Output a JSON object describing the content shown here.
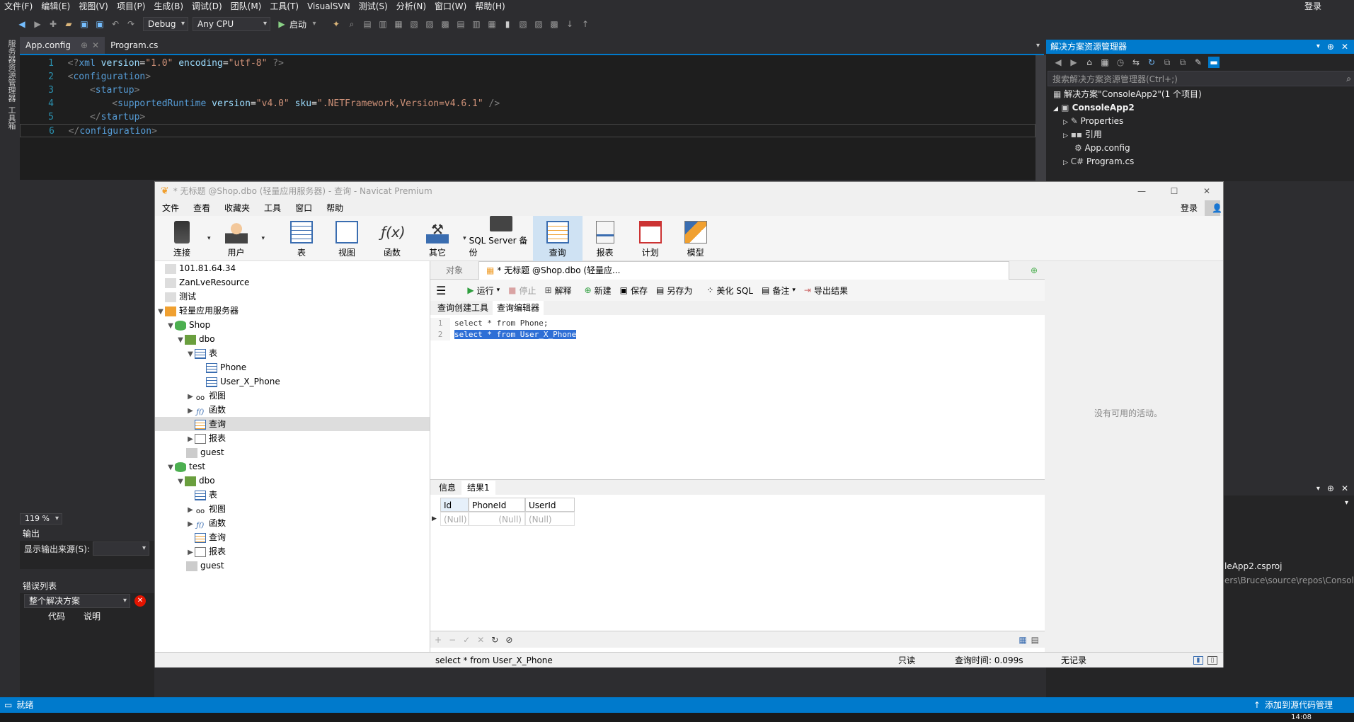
{
  "vs": {
    "menu": [
      "文件(F)",
      "编辑(E)",
      "视图(V)",
      "项目(P)",
      "生成(B)",
      "调试(D)",
      "团队(M)",
      "工具(T)",
      "VisualSVN",
      "测试(S)",
      "分析(N)",
      "窗口(W)",
      "帮助(H)"
    ],
    "login": "登录",
    "config": "Debug",
    "platform": "Any CPU",
    "start": "启动",
    "left_strip": [
      "服务器资源管理器",
      "工具箱"
    ],
    "tabs": [
      {
        "label": "App.config"
      },
      {
        "label": "Program.cs"
      }
    ],
    "code": [
      {
        "n": "1",
        "html": "<span class='xml-b'>&lt;?</span><span class='xml-t'>xml</span> <span class='xml-a'>version</span>=<span class='xml-v'>\"1.0\"</span> <span class='xml-a'>encoding</span>=<span class='xml-v'>\"utf-8\"</span> <span class='xml-b'>?&gt;</span>"
      },
      {
        "n": "2",
        "html": "<span class='xml-b'>&lt;</span><span class='xml-t'>configuration</span><span class='xml-b'>&gt;</span>"
      },
      {
        "n": "3",
        "html": "    <span class='xml-b'>&lt;</span><span class='xml-t'>startup</span><span class='xml-b'>&gt;</span>"
      },
      {
        "n": "4",
        "html": "        <span class='xml-b'>&lt;</span><span class='xml-t'>supportedRuntime</span> <span class='xml-a'>version</span>=<span class='xml-v'>\"v4.0\"</span> <span class='xml-a'>sku</span>=<span class='xml-v'>\".NETFramework,Version=v4.6.1\"</span> <span class='xml-b'>/&gt;</span>"
      },
      {
        "n": "5",
        "html": "    <span class='xml-b'>&lt;/</span><span class='xml-t'>startup</span><span class='xml-b'>&gt;</span>"
      },
      {
        "n": "6",
        "html": "<span class='xml-b'>&lt;/</span><span class='xml-t'>configuration</span><span class='xml-b'>&gt;</span>"
      }
    ],
    "zoom": "119 %",
    "output_title": "输出",
    "output_source_label": "显示输出来源(S):",
    "errors_title": "错误列表",
    "errors_scope": "整个解决方案",
    "errors_col_code": "代码",
    "errors_col_desc": "说明",
    "solution": {
      "title": "解决方案资源管理器",
      "search_placeholder": "搜索解决方案资源管理器(Ctrl+;)",
      "items": [
        "解决方案\"ConsoleApp2\"(1 个项目)",
        "ConsoleApp2",
        "Properties",
        "引用",
        "App.config",
        "Program.cs"
      ],
      "lower_items": [
        "leApp2.csproj",
        "ers\\Bruce\\source\\repos\\Consol"
      ]
    },
    "status": "就绪",
    "status_right": "添加到源代码管理",
    "clock": "14:08"
  },
  "navicat": {
    "title": "* 无标题 @Shop.dbo (轻量应用服务器) - 查询 - Navicat Premium",
    "menu": [
      "文件",
      "查看",
      "收藏夹",
      "工具",
      "窗口",
      "帮助"
    ],
    "login": "登录",
    "ribbon": [
      {
        "label": "连接",
        "icon": "plug-icon"
      },
      {
        "label": "用户",
        "icon": "user-icon"
      },
      {
        "label": "表",
        "icon": "table-icon"
      },
      {
        "label": "视图",
        "icon": "view-icon"
      },
      {
        "label": "函数",
        "icon": "function-icon"
      },
      {
        "label": "其它",
        "icon": "tools-icon"
      },
      {
        "label": "SQL Server 备份",
        "icon": "backup-icon"
      },
      {
        "label": "查询",
        "icon": "query-icon"
      },
      {
        "label": "报表",
        "icon": "report-icon"
      },
      {
        "label": "计划",
        "icon": "schedule-icon"
      },
      {
        "label": "模型",
        "icon": "model-icon"
      }
    ],
    "tree": [
      "101.81.64.34",
      "ZanLveResource",
      "测试",
      "轻量应用服务器",
      "Shop",
      "dbo",
      "表",
      "Phone",
      "User_X_Phone",
      "视图",
      "函数",
      "查询",
      "报表",
      "guest",
      "test",
      "dbo",
      "表",
      "视图",
      "函数",
      "查询",
      "报表",
      "guest"
    ],
    "tabs": {
      "objects": "对象",
      "query": "* 无标题 @Shop.dbo (轻量应..."
    },
    "toolbar": {
      "run": "运行",
      "stop": "停止",
      "explain": "解释",
      "new": "新建",
      "save": "保存",
      "save_as": "另存为",
      "beautify": "美化 SQL",
      "comment": "备注",
      "export": "导出结果"
    },
    "subtabs": {
      "builder": "查询创建工具",
      "editor": "查询编辑器"
    },
    "sql": [
      {
        "n": "1",
        "text": "select * from Phone;"
      },
      {
        "n": "2",
        "text": "select * from User_X_Phone"
      }
    ],
    "result_tabs": {
      "info": "信息",
      "result1": "结果1"
    },
    "grid": {
      "columns": [
        "Id",
        "PhoneId",
        "UserId"
      ],
      "row": [
        "(Null)",
        "(Null)",
        "(Null)"
      ]
    },
    "no_activity": "没有可用的活动。",
    "status": {
      "sql": "select * from User_X_Phone",
      "readonly": "只读",
      "time": "查询时间: 0.099s",
      "records": "无记录"
    }
  }
}
